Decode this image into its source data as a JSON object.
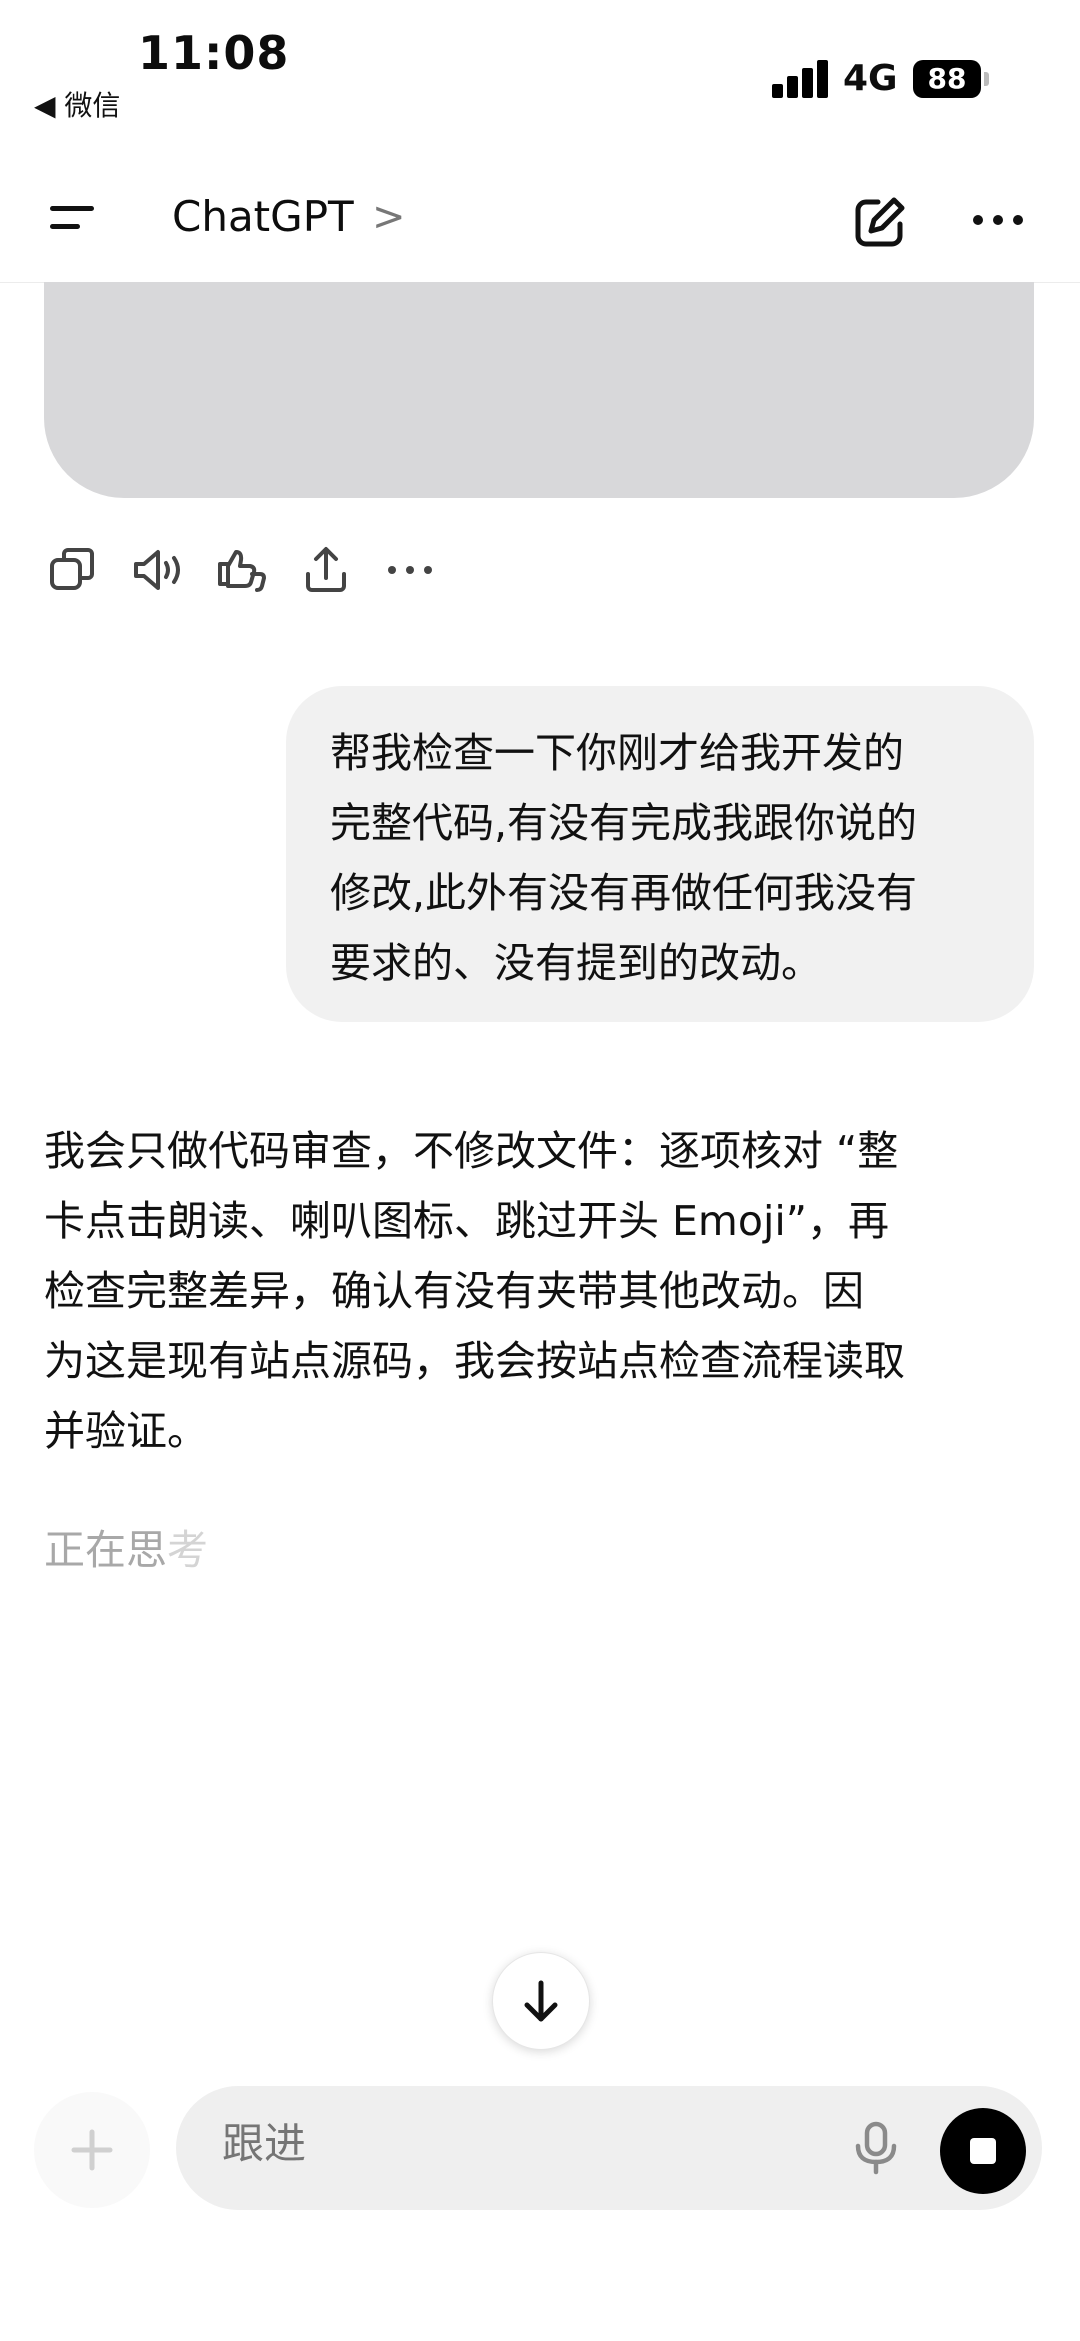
{
  "status_bar": {
    "time": "11:08",
    "back_app": "◀ 微信",
    "network": "4G",
    "battery": "88"
  },
  "header": {
    "title": "ChatGPT",
    "chevron": ">"
  },
  "message_actions": [
    "copy-icon",
    "read-aloud-icon",
    "feedback-icon",
    "share-icon",
    "more-icon"
  ],
  "user_message": {
    "lines": [
      "帮我检查一下你刚才给我开发的",
      "完整代码,有没有完成我跟你说的",
      "修改,此外有没有再做任何我没有",
      "要求的、没有提到的改动。"
    ]
  },
  "assistant_message": {
    "lines": [
      "我会只做代码审查，不修改文件：逐项核对 “整",
      "卡点击朗读、喇叭图标、跳过开头 Emoji”，再",
      "检查完整差异，确认有没有夹带其他改动。因",
      "为这是现有站点源码，我会按站点检查流程读取",
      "并验证。"
    ]
  },
  "thinking": {
    "text_main": "正在思",
    "text_fade": "考"
  },
  "composer": {
    "placeholder": "跟进"
  }
}
